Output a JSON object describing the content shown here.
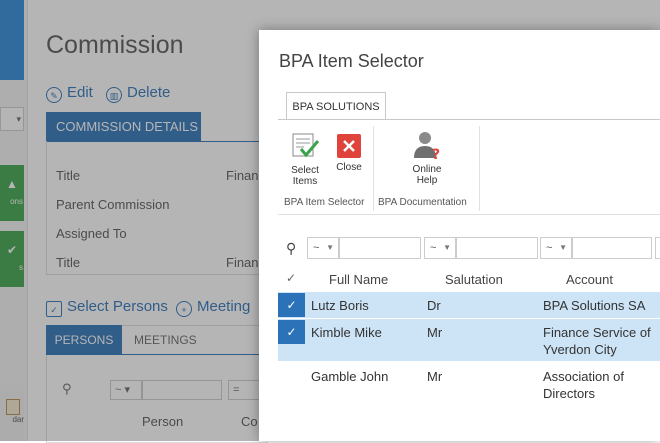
{
  "background_page": {
    "title": "Commission",
    "actions": {
      "edit": "Edit",
      "delete": "Delete"
    },
    "section_header": "COMMISSION DETAILS",
    "fields": [
      {
        "label": "Title",
        "value": "Financ"
      },
      {
        "label": "Parent Commission",
        "value": ""
      },
      {
        "label": "Assigned To",
        "value": ""
      },
      {
        "label": "Title",
        "value": "Financ"
      }
    ],
    "row_actions": {
      "select_persons": "Select Persons",
      "meeting": "Meeting"
    },
    "tabs": {
      "persons": "PERSONS",
      "meetings": "MEETINGS"
    },
    "filter_ops": [
      "~",
      "="
    ],
    "columns": [
      "Person",
      "Co"
    ],
    "left_nav": {
      "tile1": "ons",
      "tile2": "s",
      "tile3": "dar"
    }
  },
  "dialog": {
    "title": "BPA Item Selector",
    "ribbon_tab": "BPA SOLUTIONS",
    "buttons": {
      "select_items": "Select Items",
      "close": "Close",
      "online_help": "Online Help"
    },
    "groups": {
      "item_selector": "BPA Item Selector",
      "documentation": "BPA Documentation"
    },
    "filter_op": "~",
    "headers": {
      "check": "✓",
      "full_name": "Full Name",
      "salutation": "Salutation",
      "account": "Account"
    },
    "rows": [
      {
        "selected": true,
        "full_name": "Lutz Boris",
        "salutation": "Dr",
        "account": "BPA Solutions SA"
      },
      {
        "selected": true,
        "full_name": "Kimble Mike",
        "salutation": "Mr",
        "account": "Finance Service of Yverdon City"
      },
      {
        "selected": false,
        "full_name": "Gamble John",
        "salutation": "Mr",
        "account": "Association of Directors"
      }
    ]
  },
  "colors": {
    "accent_blue": "#2b72b8",
    "selected_row": "#cde4f7",
    "tile_green": "#3aa34a",
    "close_red": "#e0433b"
  }
}
